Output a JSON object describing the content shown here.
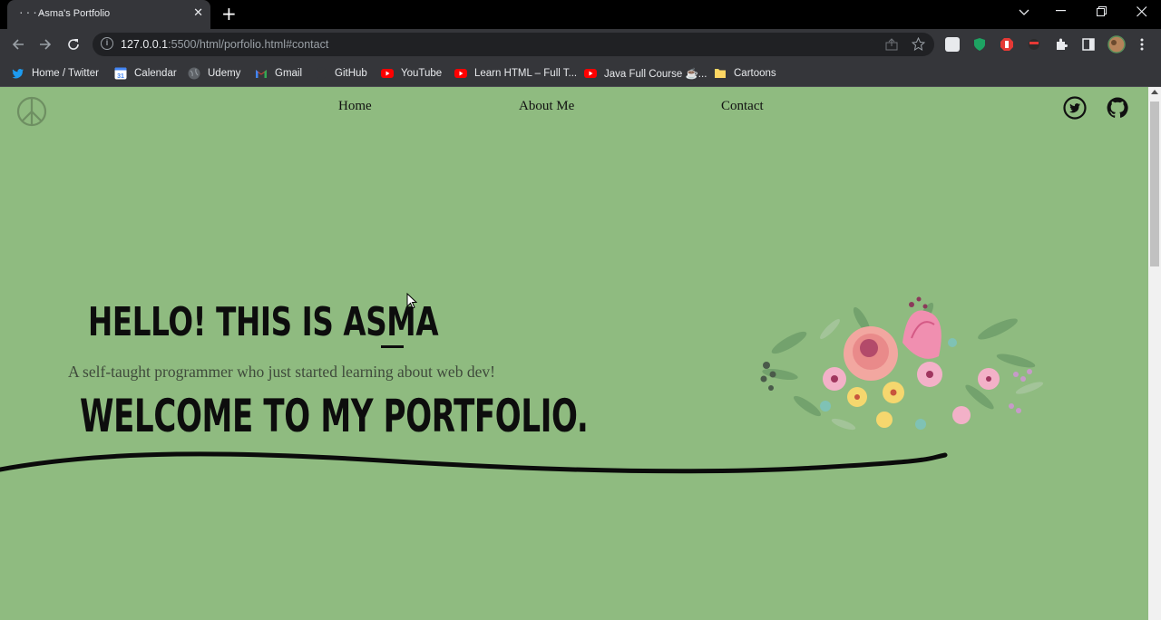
{
  "browser": {
    "tab_title": "Asma's Portfolio",
    "tab_favicon": "····",
    "tab_close": "✕",
    "new_tab": "+",
    "url_host": "127.0.0.1",
    "url_rest": ":5500/html/porfolio.html#contact",
    "bookmarks": [
      {
        "label": "Home / Twitter",
        "icon": "twitter-icon",
        "color": "#1d9bf0"
      },
      {
        "label": "Calendar",
        "icon": "calendar-icon",
        "color": "#4285f4"
      },
      {
        "label": "Udemy",
        "icon": "globe-icon",
        "color": "#5f6368"
      },
      {
        "label": "Gmail",
        "icon": "gmail-icon",
        "color": "#ea4335"
      },
      {
        "label": "GitHub",
        "icon": "github-icon",
        "color": "#35363a"
      },
      {
        "label": "YouTube",
        "icon": "youtube-icon",
        "color": "#ff0000"
      },
      {
        "label": "Learn HTML – Full T...",
        "icon": "youtube-icon",
        "color": "#ff0000"
      },
      {
        "label": "Java Full Course ☕...",
        "icon": "youtube-icon",
        "color": "#ff0000"
      },
      {
        "label": "Cartoons",
        "icon": "folder-icon",
        "color": "#fdd663"
      }
    ]
  },
  "page": {
    "background": "#8fbb80",
    "nav": {
      "home": "Home",
      "about": "About Me",
      "contact": "Contact"
    },
    "hero": {
      "line1": "HELLO! THIS IS ASMA",
      "subtitle": "A self-taught programmer who just started learning about web dev!",
      "line2": "WELCOME TO MY PORTFOLIO."
    }
  }
}
